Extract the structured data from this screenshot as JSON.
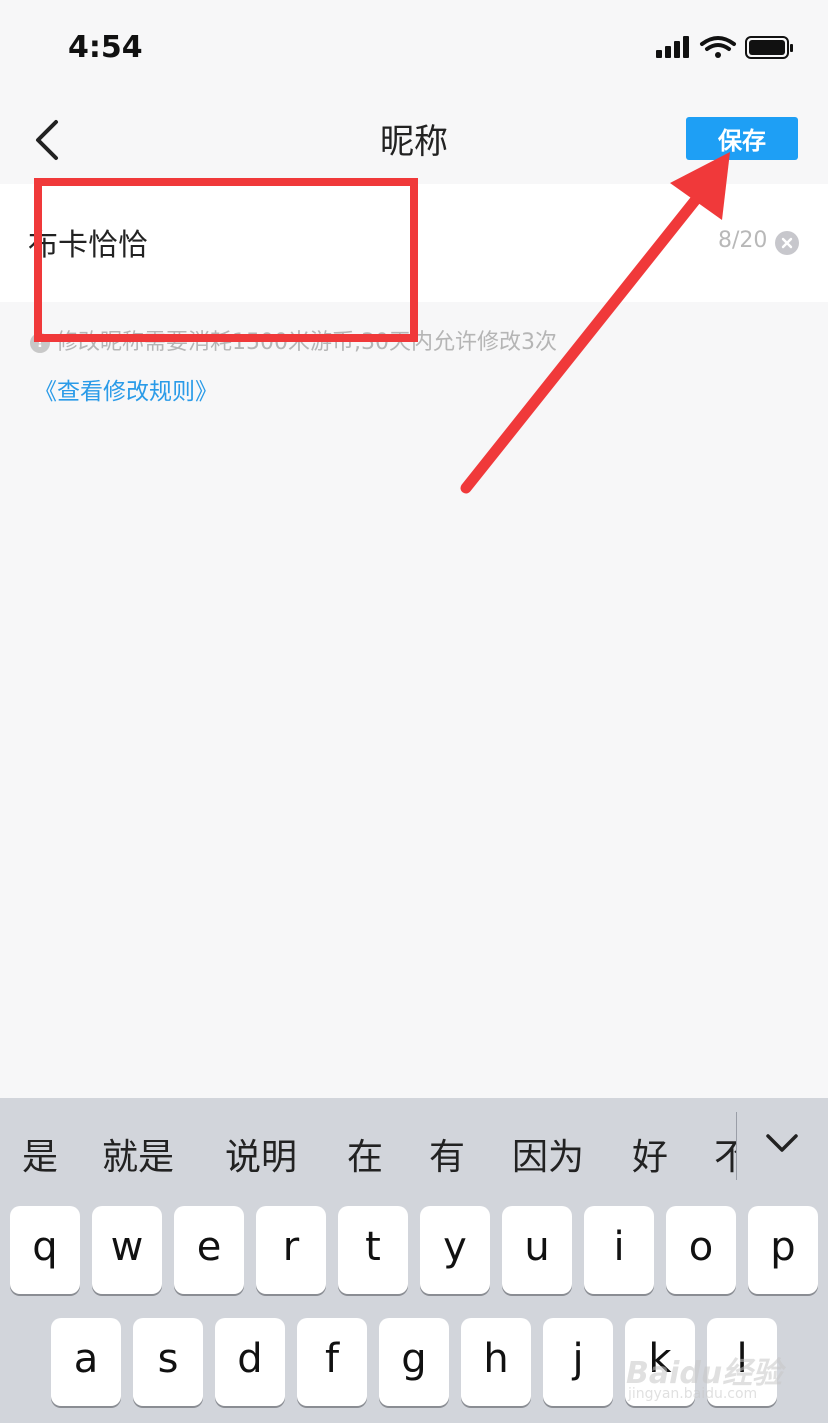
{
  "status_bar": {
    "time": "4:54"
  },
  "nav": {
    "title": "昵称",
    "save_label": "保存"
  },
  "nickname": {
    "value": "布卡恰恰",
    "count": "8/20"
  },
  "hint": {
    "text": "修改昵称需要消耗1500米游币,30天内允许修改3次"
  },
  "rules_link": "《查看修改规则》",
  "keyboard": {
    "candidates": [
      "是",
      "就是",
      "说明",
      "在",
      "有",
      "因为",
      "好",
      "不"
    ],
    "row1": [
      "q",
      "w",
      "e",
      "r",
      "t",
      "y",
      "u",
      "i",
      "o",
      "p"
    ],
    "row2": [
      "a",
      "s",
      "d",
      "f",
      "g",
      "h",
      "j",
      "k",
      "l"
    ]
  },
  "watermark": {
    "text": "Baidu经验",
    "sub": "jingyan.baidu.com"
  },
  "colors": {
    "accent": "#1e9ff5",
    "annotation": "#f0393a",
    "link": "#2a9be8"
  },
  "icons": [
    "signal-icon",
    "wifi-icon",
    "battery-icon",
    "back-chevron-icon",
    "clear-icon",
    "info-icon",
    "chevron-down-icon"
  ]
}
